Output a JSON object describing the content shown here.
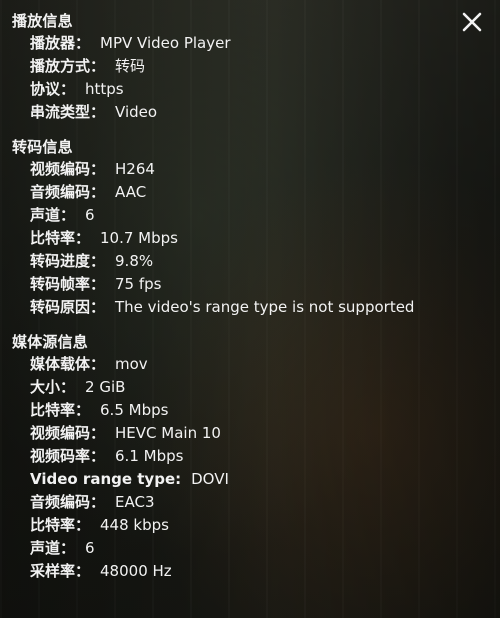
{
  "close_icon": "close-icon",
  "sections": [
    {
      "title": "播放信息",
      "rows": [
        {
          "label": "播放器：",
          "value": "MPV Video Player"
        },
        {
          "label": "播放方式：",
          "value": "转码"
        },
        {
          "label": "协议：",
          "value": "https"
        },
        {
          "label": "串流类型：",
          "value": "Video"
        }
      ]
    },
    {
      "title": "转码信息",
      "rows": [
        {
          "label": "视频编码：",
          "value": "H264"
        },
        {
          "label": "音频编码：",
          "value": "AAC"
        },
        {
          "label": "声道：",
          "value": "6"
        },
        {
          "label": "比特率：",
          "value": "10.7 Mbps"
        },
        {
          "label": "转码进度：",
          "value": "9.8%"
        },
        {
          "label": "转码帧率：",
          "value": "75 fps"
        },
        {
          "label": "转码原因：",
          "value": "The video's range type is not supported"
        }
      ]
    },
    {
      "title": "媒体源信息",
      "rows": [
        {
          "label": "媒体载体：",
          "value": "mov"
        },
        {
          "label": "大小：",
          "value": "2 GiB"
        },
        {
          "label": "比特率：",
          "value": "6.5 Mbps"
        },
        {
          "label": "视频编码：",
          "value": "HEVC Main 10"
        },
        {
          "label": "视频码率：",
          "value": "6.1 Mbps"
        },
        {
          "label": "Video range type:",
          "value": "DOVI"
        },
        {
          "label": "音频编码：",
          "value": "EAC3"
        },
        {
          "label": "比特率：",
          "value": "448 kbps"
        },
        {
          "label": "声道：",
          "value": "6"
        },
        {
          "label": "采样率：",
          "value": "48000 Hz"
        }
      ]
    }
  ]
}
